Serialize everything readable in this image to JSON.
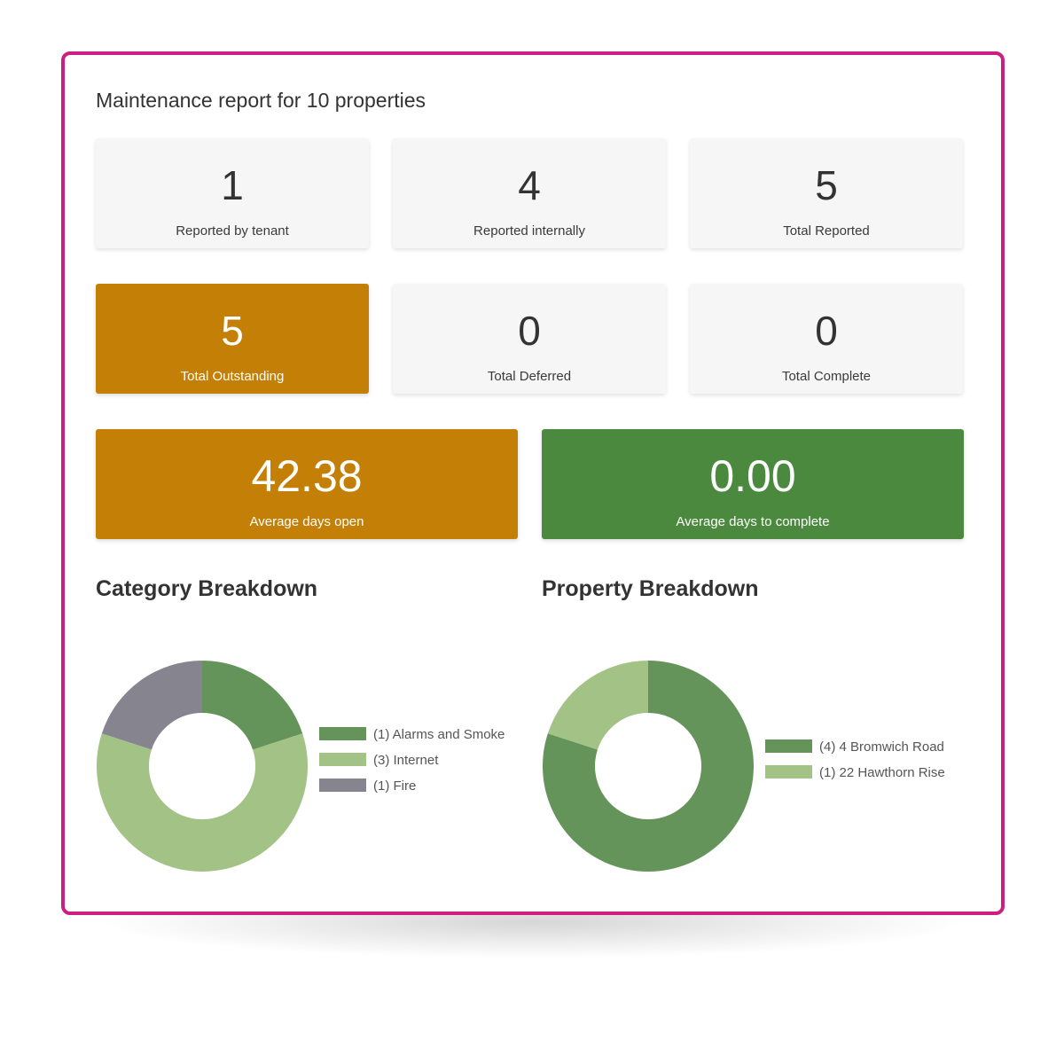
{
  "report": {
    "title": "Maintenance report for 10 properties"
  },
  "stats_row1": [
    {
      "value": "1",
      "label": "Reported by tenant"
    },
    {
      "value": "4",
      "label": "Reported internally"
    },
    {
      "value": "5",
      "label": "Total Reported"
    }
  ],
  "stats_row2": [
    {
      "value": "5",
      "label": "Total Outstanding",
      "color": "#c48006"
    },
    {
      "value": "0",
      "label": "Total Deferred"
    },
    {
      "value": "0",
      "label": "Total Complete"
    }
  ],
  "stats_row3": [
    {
      "value": "42.38",
      "label": "Average days open",
      "color": "#c48006"
    },
    {
      "value": "0.00",
      "label": "Average days to complete",
      "color": "#4b8a3e"
    }
  ],
  "colors": {
    "frame": "#cc1f7f",
    "amber": "#c48006",
    "green": "#4b8a3e"
  },
  "chart_data": [
    {
      "type": "pie",
      "title": "Category Breakdown",
      "donut": true,
      "legend": "right",
      "slices": [
        {
          "label": "(1) Alarms and Smoke",
          "value": 1,
          "color": "#65945a"
        },
        {
          "label": "(3) Internet",
          "value": 3,
          "color": "#a2c286"
        },
        {
          "label": "(1) Fire",
          "value": 1,
          "color": "#86848f"
        }
      ]
    },
    {
      "type": "pie",
      "title": "Property Breakdown",
      "donut": true,
      "legend": "right",
      "slices": [
        {
          "label": "(4) 4 Bromwich Road",
          "value": 4,
          "color": "#65945a"
        },
        {
          "label": "(1) 22 Hawthorn Rise",
          "value": 1,
          "color": "#a2c286"
        }
      ]
    }
  ]
}
